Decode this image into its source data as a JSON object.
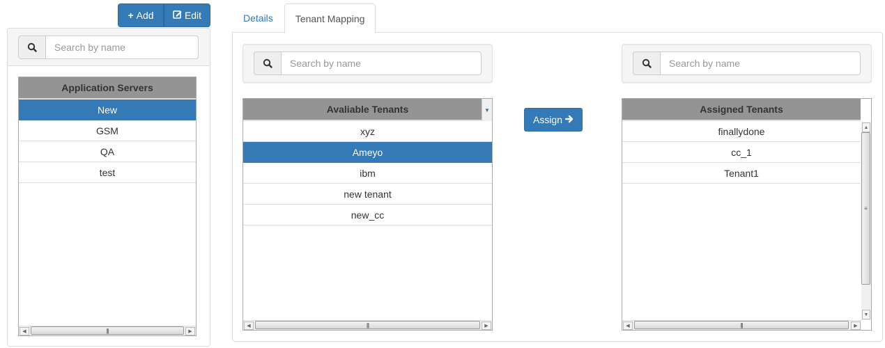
{
  "toolbar": {
    "add_label": "Add",
    "add_icon": "plus-icon",
    "edit_label": "Edit",
    "edit_icon": "edit-icon"
  },
  "left_panel": {
    "search_placeholder": "Search by name",
    "search_value": "",
    "grid": {
      "header": "Application Servers",
      "rows": [
        "New",
        "GSM",
        "QA",
        "test"
      ],
      "selected_index": 0
    }
  },
  "tabs": [
    {
      "label": "Details",
      "active": false
    },
    {
      "label": "Tenant Mapping",
      "active": true
    }
  ],
  "tenant_mapping": {
    "available": {
      "search_placeholder": "Search by name",
      "search_value": "",
      "header": "Avaliable Tenants",
      "rows": [
        "xyz",
        "Ameyo",
        "ibm",
        "new tenant",
        "new_cc"
      ],
      "selected_index": 1
    },
    "assign_button": {
      "label": "Assign",
      "icon": "arrow-right-icon"
    },
    "assigned": {
      "search_placeholder": "Search by name",
      "search_value": "",
      "header": "Assigned Tenants",
      "rows": [
        "finallydone",
        "cc_1",
        "Tenant1"
      ]
    }
  },
  "colors": {
    "primary": "#337ab7",
    "grid_header": "#949494",
    "tab_link": "#337ab7"
  }
}
